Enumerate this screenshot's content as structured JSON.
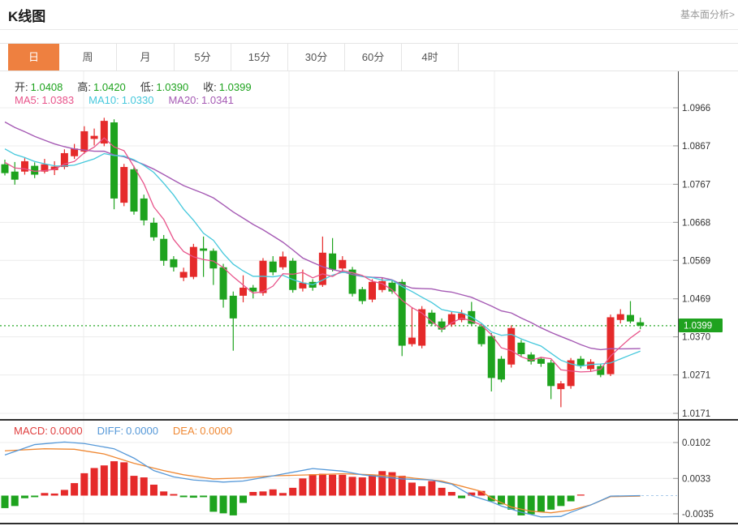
{
  "header": {
    "title": "K线图",
    "link_label": "基本面分析>"
  },
  "tabs": {
    "items": [
      {
        "label": "日",
        "active": true
      },
      {
        "label": "周",
        "active": false
      },
      {
        "label": "月",
        "active": false
      },
      {
        "label": "5分",
        "active": false
      },
      {
        "label": "15分",
        "active": false
      },
      {
        "label": "30分",
        "active": false
      },
      {
        "label": "60分",
        "active": false
      },
      {
        "label": "4时",
        "active": false
      }
    ]
  },
  "colors": {
    "up": "#e52a2a",
    "down": "#1ea31e",
    "ma5": "#e8538a",
    "ma10": "#45c8dc",
    "ma20": "#a55ab4",
    "diff": "#5598d8",
    "dea": "#ef8833",
    "macd_label": "#e03e3e",
    "price_line": "#28a828",
    "badge_bg": "#1fa21f",
    "badge_text": "#ffffff",
    "grid": "#ececec",
    "axis": "#4a4a4a",
    "tick": "#999999",
    "label_text": "#333333",
    "divider_dark": "#2e2e2e",
    "zero_dash": "#a9cbe9"
  },
  "legend": {
    "ohlc": [
      {
        "label": "开:",
        "value": "1.0408"
      },
      {
        "label": "高:",
        "value": "1.0420"
      },
      {
        "label": "低:",
        "value": "1.0390"
      },
      {
        "label": "收:",
        "value": "1.0399"
      }
    ],
    "ma": [
      {
        "label": "MA5:",
        "value": "1.0383",
        "color_key": "ma5"
      },
      {
        "label": "MA10:",
        "value": "1.0330",
        "color_key": "ma10"
      },
      {
        "label": "MA20:",
        "value": "1.0341",
        "color_key": "ma20"
      }
    ]
  },
  "macd_legend": [
    {
      "label": "MACD:",
      "value": "0.0000",
      "color_key": "macd_label"
    },
    {
      "label": "DIFF:",
      "value": "0.0000",
      "color_key": "diff"
    },
    {
      "label": "DEA:",
      "value": "0.0000",
      "color_key": "dea"
    }
  ],
  "chart_data": [
    {
      "type": "candlestick",
      "title": "K线图",
      "period": "日",
      "legend_ohlc": {
        "open": 1.0408,
        "high": 1.042,
        "low": 1.039,
        "close": 1.0399
      },
      "legend_ma": {
        "MA5": 1.0383,
        "MA10": 1.033,
        "MA20": 1.0341
      },
      "current_price": "1.0399",
      "y_ticks": [
        1.0966,
        1.0867,
        1.0767,
        1.0668,
        1.0569,
        1.0469,
        1.037,
        1.0271,
        1.0171
      ],
      "grid": true,
      "candles": [
        [
          1.0819,
          1.0831,
          1.079,
          1.0796
        ],
        [
          1.08,
          1.0825,
          1.0766,
          1.0779
        ],
        [
          1.08,
          1.0835,
          1.0792,
          1.0827
        ],
        [
          1.0815,
          1.0824,
          1.0783,
          1.0792
        ],
        [
          1.08,
          1.0833,
          1.0795,
          1.0819
        ],
        [
          1.0804,
          1.0827,
          1.0791,
          1.0813
        ],
        [
          1.0812,
          1.0858,
          1.0806,
          1.0848
        ],
        [
          1.084,
          1.0872,
          1.0833,
          1.086
        ],
        [
          1.0852,
          1.0918,
          1.0846,
          1.0905
        ],
        [
          1.0885,
          1.0912,
          1.0868,
          1.0893
        ],
        [
          1.0873,
          1.094,
          1.0866,
          1.0932
        ],
        [
          1.0928,
          1.0936,
          1.0702,
          1.073
        ],
        [
          1.0719,
          1.082,
          1.071,
          1.0812
        ],
        [
          1.0806,
          1.0815,
          1.0688,
          1.0696
        ],
        [
          1.073,
          1.074,
          1.066,
          1.0673
        ],
        [
          1.0667,
          1.068,
          1.062,
          1.0629
        ],
        [
          1.0625,
          1.0635,
          1.0555,
          1.0568
        ],
        [
          1.0572,
          1.058,
          1.054,
          1.0551
        ],
        [
          1.0524,
          1.055,
          1.0515,
          1.0539
        ],
        [
          1.0526,
          1.0612,
          1.052,
          1.0604
        ],
        [
          1.06,
          1.0631,
          1.0526,
          1.0594
        ],
        [
          1.0594,
          1.06,
          1.0505,
          1.0548
        ],
        [
          1.0551,
          1.056,
          1.0446,
          1.0467
        ],
        [
          1.0477,
          1.0488,
          1.0334,
          1.0418
        ],
        [
          1.0477,
          1.053,
          1.046,
          1.0498
        ],
        [
          1.0498,
          1.0505,
          1.047,
          1.0488
        ],
        [
          1.0484,
          1.0575,
          1.0477,
          1.0568
        ],
        [
          1.0566,
          1.058,
          1.053,
          1.0538
        ],
        [
          1.0551,
          1.0592,
          1.0545,
          1.0579
        ],
        [
          1.0568,
          1.0575,
          1.0485,
          1.0492
        ],
        [
          1.0496,
          1.0545,
          1.0488,
          1.0511
        ],
        [
          1.0513,
          1.052,
          1.049,
          1.0498
        ],
        [
          1.0505,
          1.0631,
          1.05,
          1.0589
        ],
        [
          1.0587,
          1.0627,
          1.054,
          1.0545
        ],
        [
          1.0548,
          1.058,
          1.0542,
          1.057
        ],
        [
          1.0545,
          1.0552,
          1.0475,
          1.0482
        ],
        [
          1.0494,
          1.05,
          1.0455,
          1.0463
        ],
        [
          1.0467,
          1.052,
          1.046,
          1.0513
        ],
        [
          1.0492,
          1.0525,
          1.0486,
          1.0515
        ],
        [
          1.0511,
          1.0518,
          1.0482,
          1.0488
        ],
        [
          1.0513,
          1.052,
          1.032,
          1.0347
        ],
        [
          1.0351,
          1.0446,
          1.0345,
          1.0368
        ],
        [
          1.0347,
          1.045,
          1.034,
          1.0442
        ],
        [
          1.0433,
          1.044,
          1.0398,
          1.0404
        ],
        [
          1.041,
          1.0418,
          1.0382,
          1.0389
        ],
        [
          1.0402,
          1.0435,
          1.0396,
          1.0429
        ],
        [
          1.0414,
          1.044,
          1.0408,
          1.0431
        ],
        [
          1.0437,
          1.0461,
          1.04,
          1.0404
        ],
        [
          1.0397,
          1.0405,
          1.0345,
          1.0351
        ],
        [
          1.0372,
          1.038,
          1.0228,
          1.0263
        ],
        [
          1.0313,
          1.032,
          1.0252,
          1.0259
        ],
        [
          1.0298,
          1.04,
          1.029,
          1.0393
        ],
        [
          1.0355,
          1.0362,
          1.0318,
          1.0325
        ],
        [
          1.0324,
          1.033,
          1.0298,
          1.0306
        ],
        [
          1.0313,
          1.0318,
          1.0292,
          1.03
        ],
        [
          1.0303,
          1.031,
          1.0208,
          1.0242
        ],
        [
          1.0234,
          1.0255,
          1.0187,
          1.0249
        ],
        [
          1.0242,
          1.0315,
          1.0235,
          1.0309
        ],
        [
          1.0313,
          1.032,
          1.0288,
          1.0294
        ],
        [
          1.0286,
          1.0312,
          1.028,
          1.0305
        ],
        [
          1.0294,
          1.03,
          1.0265,
          1.0271
        ],
        [
          1.0273,
          1.0428,
          1.0268,
          1.0421
        ],
        [
          1.0414,
          1.0442,
          1.0405,
          1.0429
        ],
        [
          1.0427,
          1.0463,
          1.0405,
          1.041
        ],
        [
          1.0408,
          1.042,
          1.039,
          1.0399
        ]
      ]
    },
    {
      "type": "bar",
      "name": "MACD",
      "legend": {
        "MACD": 0.0,
        "DIFF": 0.0,
        "DEA": 0.0
      },
      "y_ticks": [
        0.0102,
        0.0033,
        -0.0035
      ],
      "histogram": [
        -0.0024,
        -0.002,
        -0.0005,
        -0.0003,
        0.0005,
        0.0004,
        0.0011,
        0.0024,
        0.0043,
        0.0053,
        0.0058,
        0.0066,
        0.0064,
        0.0038,
        0.0035,
        0.0021,
        0.0008,
        0.0003,
        -0.0003,
        -0.0004,
        -0.0003,
        -0.0031,
        -0.0034,
        -0.0038,
        -0.0014,
        0.0007,
        0.0008,
        0.0012,
        0.0005,
        0.0015,
        0.0033,
        0.0041,
        0.0042,
        0.004,
        0.004,
        0.0036,
        0.0035,
        0.004,
        0.0047,
        0.0045,
        0.0038,
        0.0025,
        0.0018,
        0.0028,
        0.0015,
        0.0007,
        -0.0005,
        0.0006,
        0.0009,
        -0.0011,
        -0.0017,
        -0.0027,
        -0.0038,
        -0.0036,
        -0.0031,
        -0.0027,
        -0.002,
        -0.0011,
        0.0002,
        0,
        0,
        0,
        0,
        0,
        0
      ],
      "diff_line": [
        [
          0,
          0.0078
        ],
        [
          3,
          0.0098
        ],
        [
          6,
          0.0103
        ],
        [
          8,
          0.01
        ],
        [
          11,
          0.009
        ],
        [
          13,
          0.0072
        ],
        [
          15,
          0.0048
        ],
        [
          17,
          0.0036
        ],
        [
          19,
          0.003
        ],
        [
          22,
          0.0026
        ],
        [
          24,
          0.0028
        ],
        [
          27,
          0.0038
        ],
        [
          31,
          0.0052
        ],
        [
          34,
          0.0047
        ],
        [
          36,
          0.004
        ],
        [
          40,
          0.0032
        ],
        [
          43,
          0.003
        ],
        [
          45,
          0.0022
        ],
        [
          47,
          0.0
        ],
        [
          49,
          -0.0012
        ],
        [
          50,
          -0.002
        ],
        [
          52,
          -0.0032
        ],
        [
          54,
          -0.0041
        ],
        [
          56,
          -0.004
        ],
        [
          57,
          -0.0032
        ],
        [
          59,
          -0.0018
        ],
        [
          61,
          -0.0001
        ],
        [
          64,
          0.0
        ]
      ],
      "dea_line": [
        [
          0,
          0.0086
        ],
        [
          4,
          0.009
        ],
        [
          7,
          0.0089
        ],
        [
          10,
          0.008
        ],
        [
          13,
          0.0062
        ],
        [
          16,
          0.0048
        ],
        [
          18,
          0.004
        ],
        [
          21,
          0.0032
        ],
        [
          24,
          0.0034
        ],
        [
          27,
          0.0038
        ],
        [
          31,
          0.004
        ],
        [
          34,
          0.0042
        ],
        [
          37,
          0.004
        ],
        [
          40,
          0.0036
        ],
        [
          44,
          0.0028
        ],
        [
          46,
          0.0018
        ],
        [
          48,
          0.0008
        ],
        [
          49,
          -0.0005
        ],
        [
          51,
          -0.0022
        ],
        [
          53,
          -0.003
        ],
        [
          55,
          -0.0033
        ],
        [
          57,
          -0.0028
        ],
        [
          59,
          -0.0018
        ],
        [
          61,
          -0.0002
        ],
        [
          64,
          -0.0001
        ]
      ]
    }
  ]
}
